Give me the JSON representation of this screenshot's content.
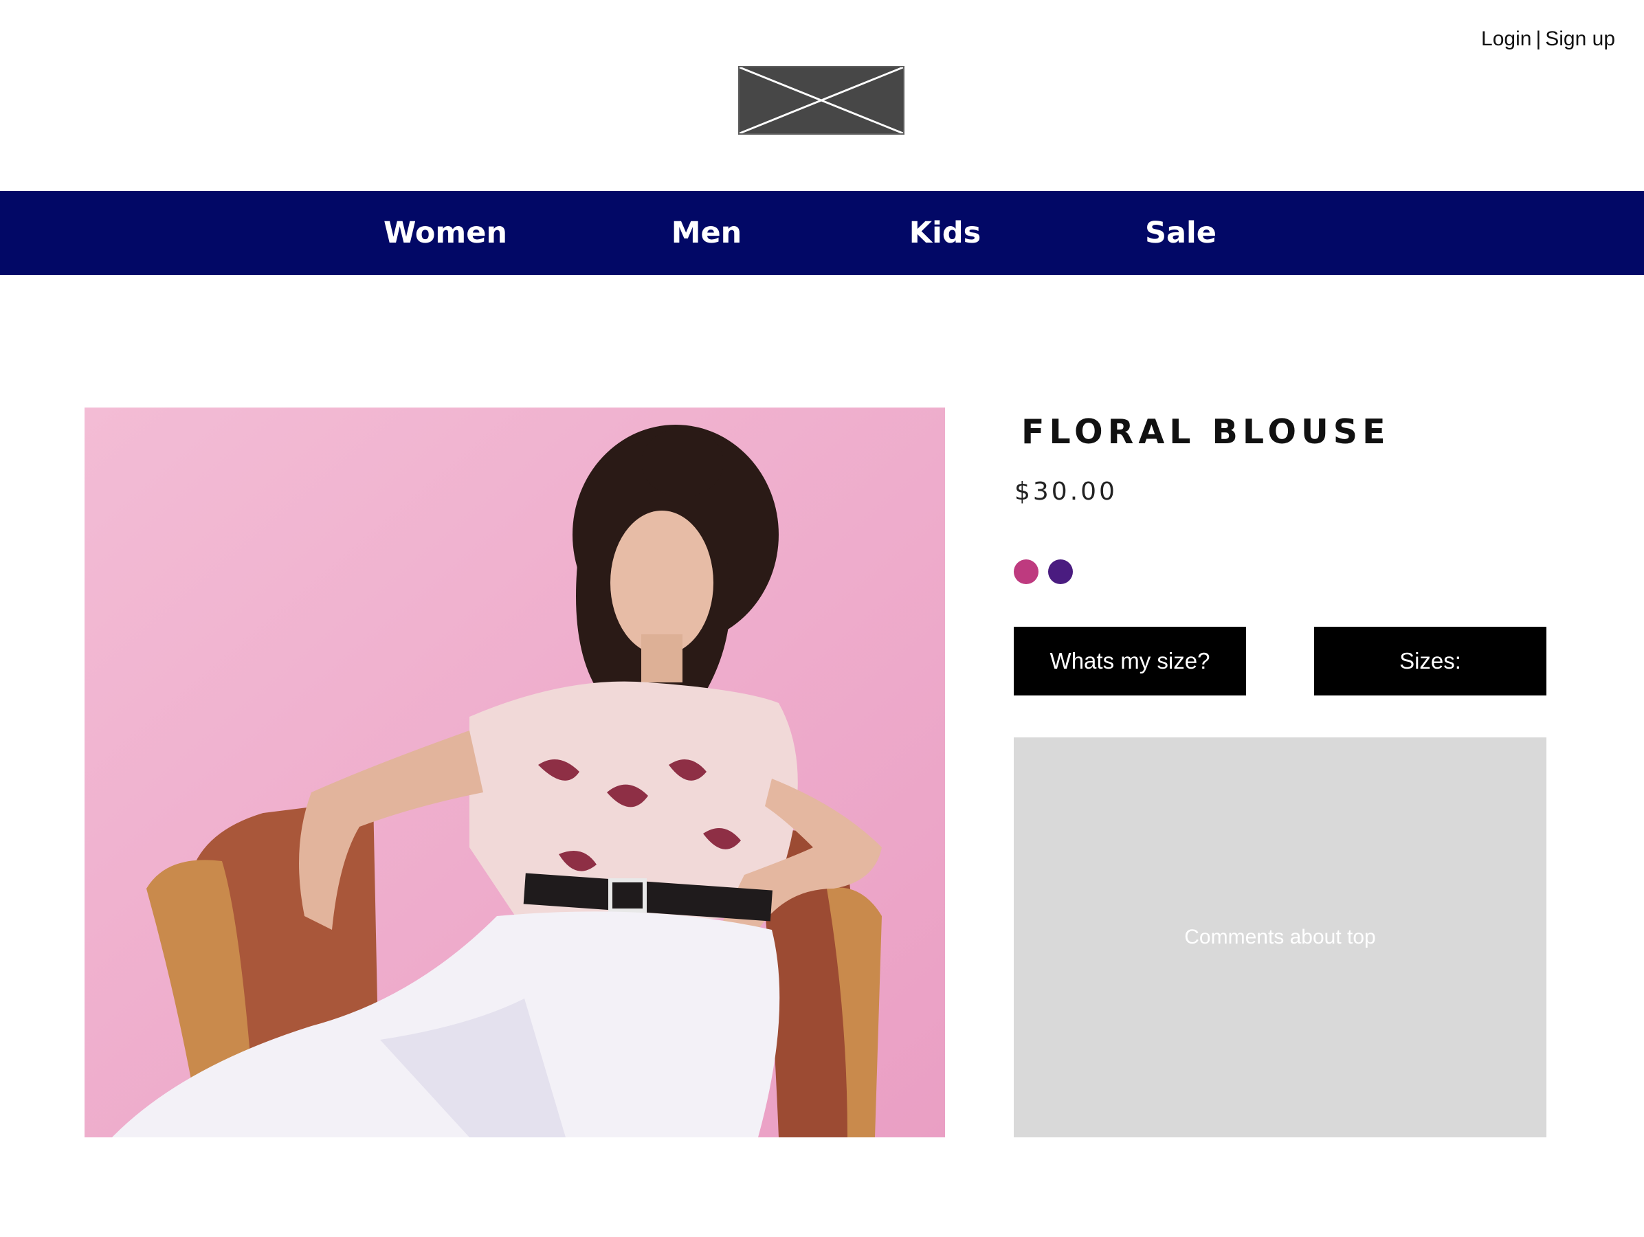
{
  "header": {
    "login_label": "Login",
    "separator": "|",
    "signup_label": "Sign up",
    "logo_icon": "image-placeholder-icon"
  },
  "nav": {
    "items": [
      {
        "label": "Women"
      },
      {
        "label": "Men"
      },
      {
        "label": "Kids"
      },
      {
        "label": "Sale"
      }
    ],
    "background_color": "#020866"
  },
  "product": {
    "image_icon": "product-photo",
    "title": "FLORAL BLOUSE",
    "price": "$30.00",
    "colors": [
      "#be3a7f",
      "#4a1c80"
    ],
    "size_guide_label": "Whats my size?",
    "sizes_label": "Sizes:",
    "comments_placeholder": "Comments about top"
  }
}
